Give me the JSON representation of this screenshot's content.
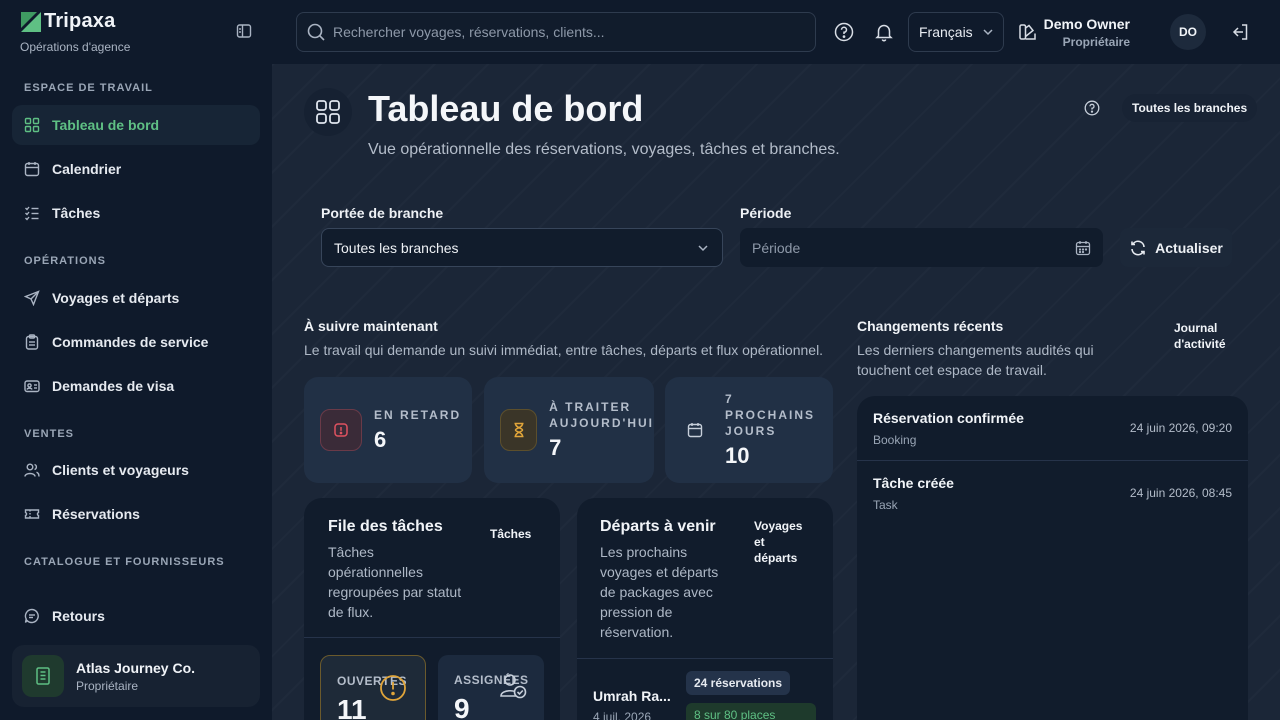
{
  "brand": {
    "name": "Tripaxa",
    "subtitle": "Opérations d'agence"
  },
  "sidebar": {
    "sections": [
      {
        "label": "ESPACE DE TRAVAIL"
      },
      {
        "label": "OPÉRATIONS"
      },
      {
        "label": "VENTES"
      },
      {
        "label": "CATALOGUE ET FOURNISSEURS"
      }
    ],
    "items": [
      {
        "label": "Tableau de bord",
        "icon": "dashboard-icon"
      },
      {
        "label": "Calendrier",
        "icon": "calendar-icon"
      },
      {
        "label": "Tâches",
        "icon": "list-checks-icon"
      },
      {
        "label": "Voyages et départs",
        "icon": "send-icon"
      },
      {
        "label": "Commandes de service",
        "icon": "clipboard-icon"
      },
      {
        "label": "Demandes de visa",
        "icon": "id-card-icon"
      },
      {
        "label": "Clients et voyageurs",
        "icon": "users-icon"
      },
      {
        "label": "Réservations",
        "icon": "ticket-icon"
      },
      {
        "label": "Retours",
        "icon": "message-icon"
      }
    ],
    "org": {
      "name": "Atlas Journey Co.",
      "role": "Propriétaire"
    }
  },
  "topbar": {
    "search_placeholder": "Rechercher voyages, réservations, clients...",
    "language": "Français",
    "user": {
      "name": "Demo Owner",
      "role": "Propriétaire",
      "initials": "DO"
    }
  },
  "page": {
    "title": "Tableau de bord",
    "subtitle": "Vue opérationnelle des réservations, voyages, tâches et branches.",
    "branch_chip": "Toutes les branches"
  },
  "filters": {
    "branch_label": "Portée de branche",
    "branch_value": "Toutes les branches",
    "period_label": "Période",
    "period_placeholder": "Période",
    "refresh_label": "Actualiser"
  },
  "follow": {
    "title": "À suivre maintenant",
    "desc": "Le travail qui demande un suivi immédiat, entre tâches, départs et flux opérationnel.",
    "stats": [
      {
        "label": "EN RETARD",
        "value": "6"
      },
      {
        "label1": "À TRAITER",
        "label2": "AUJOURD'HUI",
        "value": "7"
      },
      {
        "label1": "7",
        "label2": "PROCHAINS",
        "label3": "JOURS",
        "value": "10"
      }
    ]
  },
  "tasks_card": {
    "title": "File des tâches",
    "desc_lines": [
      "Tâches",
      "opérationnelles",
      "regroupées par statut",
      "de flux."
    ],
    "link": "Tâches",
    "open_label": "OUVERTES",
    "open_value": "11",
    "assigned_label": "ASSIGNÉES",
    "assigned_value": "9"
  },
  "departures_card": {
    "title": "Départs à venir",
    "desc_lines": [
      "Les prochains",
      "voyages et départs",
      "de packages avec",
      "pression de",
      "réservation."
    ],
    "link_lines": [
      "Voyages",
      "et",
      "départs"
    ],
    "trip_name": "Umrah Ra...",
    "trip_date": "4 juil. 2026",
    "bookings": "24 réservations",
    "places": "8 sur 80 places"
  },
  "changes": {
    "title": "Changements récents",
    "desc_lines": [
      "Les derniers changements audités qui",
      "touchent cet espace de travail."
    ],
    "link_lines": [
      "Journal",
      "d'activité"
    ],
    "items": [
      {
        "title": "Réservation confirmée",
        "category": "Booking",
        "date": "24 juin 2026, 09:20"
      },
      {
        "title": "Tâche créée",
        "category": "Task",
        "date": "24 juin 2026, 08:45"
      }
    ]
  },
  "colors": {
    "accent": "#5fc084",
    "danger": "#e05260",
    "warning": "#e0a53a",
    "background": "#1b2637",
    "sidebar": "#0f1a2b"
  }
}
